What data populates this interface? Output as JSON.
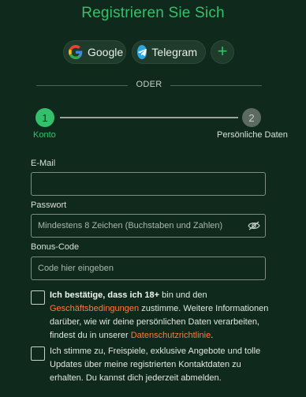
{
  "title": "Registrieren Sie Sich",
  "social": {
    "google_label": "Google",
    "telegram_label": "Telegram",
    "more_label": "+"
  },
  "divider": {
    "text": "ODER"
  },
  "stepper": {
    "step1": {
      "number": "1",
      "label": "Konto"
    },
    "step2": {
      "number": "2",
      "label": "Persönliche Daten"
    }
  },
  "form": {
    "email": {
      "label": "E-Mail",
      "placeholder": ""
    },
    "password": {
      "label": "Passwort",
      "placeholder": "Mindestens 8 Zeichen (Buchstaben und Zahlen)"
    },
    "bonus": {
      "label": "Bonus-Code",
      "placeholder": "Code hier eingeben"
    }
  },
  "consent1": {
    "bold": "Ich bestätige, dass ich 18+",
    "text1": " bin und den ",
    "link1": "Geschäftsbedingungen",
    "text2": " zustimme. Weitere Informationen darüber, wie wir deine persönlichen Daten verarbeiten, findest du in unserer ",
    "link2": "Datenschutzrichtlinie",
    "text3": "."
  },
  "consent2": {
    "text": "Ich stimme zu, Freispiele, exklusive Angebote und tolle Updates über meine registrierten Kontaktdaten zu erhalten. Du kannst dich jederzeit abmelden."
  },
  "colors": {
    "background": "#0f2a1c",
    "accent": "#34c06a",
    "link": "#ff7a3d"
  }
}
